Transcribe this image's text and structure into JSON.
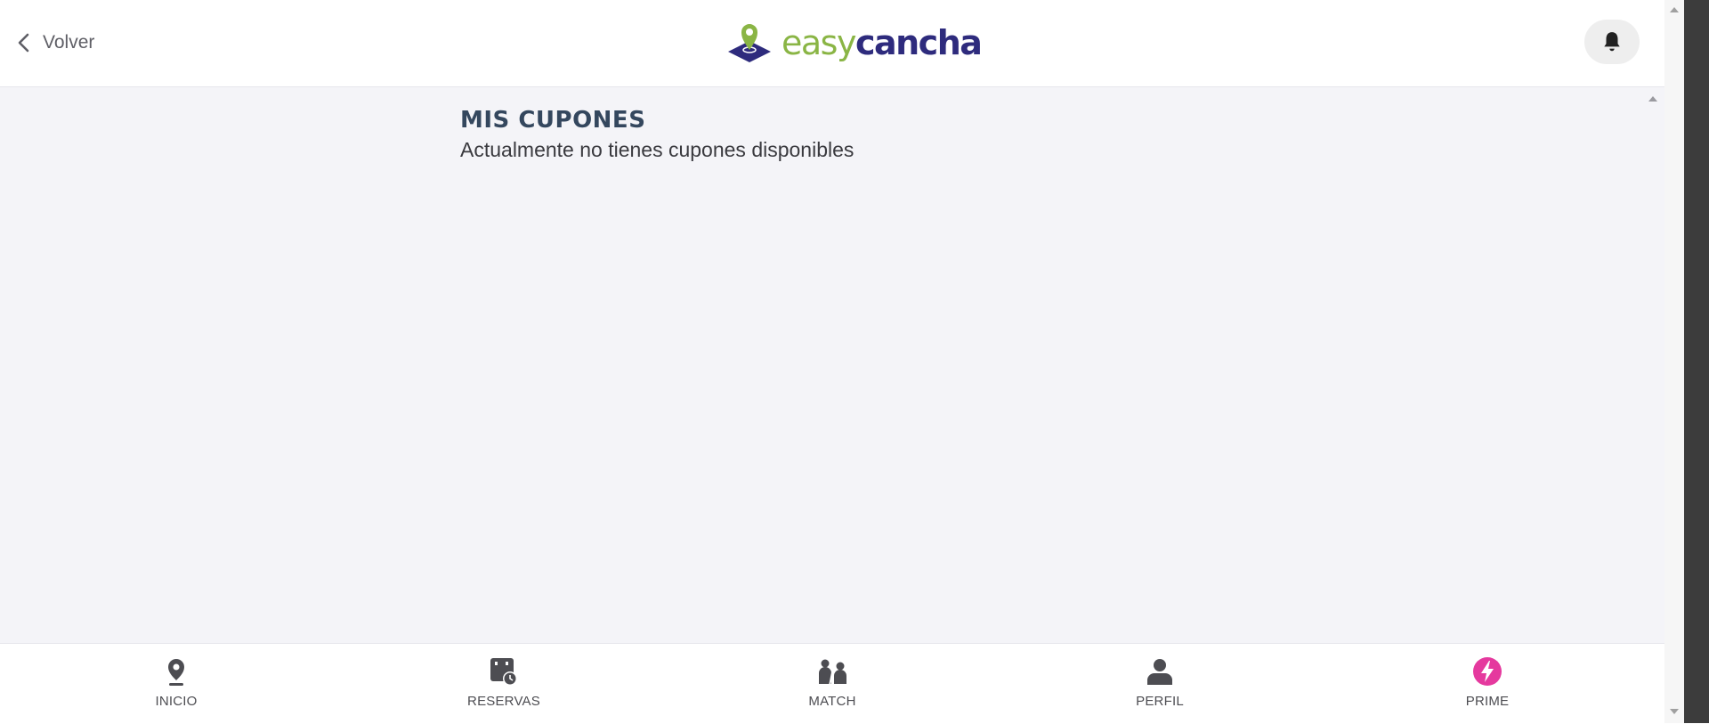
{
  "header": {
    "back_label": "Volver",
    "logo": {
      "part1": "easy",
      "part2": "cancha",
      "part1_color": "#8ab545",
      "part2_color": "#2e2b7d"
    },
    "notification_icon": "bell-icon"
  },
  "main": {
    "title": "MIS CUPONES",
    "message": "Actualmente no tienes cupones disponibles"
  },
  "bottom_nav": {
    "items": [
      {
        "label": "INICIO",
        "icon": "location-pin-icon"
      },
      {
        "label": "RESERVAS",
        "icon": "calendar-clock-icon"
      },
      {
        "label": "MATCH",
        "icon": "players-versus-icon"
      },
      {
        "label": "PERFIL",
        "icon": "user-icon"
      },
      {
        "label": "PRIME",
        "icon": "lightning-icon",
        "color": "#e5399e"
      }
    ]
  },
  "colors": {
    "background": "#f4f4f8",
    "title": "#34475e",
    "icon": "#4d4d52"
  }
}
